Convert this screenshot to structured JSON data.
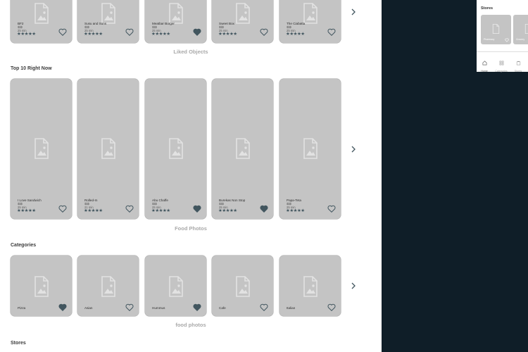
{
  "sections": {
    "top_row": {
      "caption": "Liked Objects",
      "cards": [
        {
          "name": "BF2",
          "price": "$$$",
          "time": "25 min",
          "liked": false
        },
        {
          "name": "Susu and Sons",
          "price": "$$$",
          "time": "25 min",
          "liked": false
        },
        {
          "name": "Meatbar Burger",
          "price": "$$$",
          "time": "25 min",
          "liked": true
        },
        {
          "name": "Sweet Box",
          "price": "$$$",
          "time": "25 min",
          "liked": false
        },
        {
          "name": "The Ciabatta",
          "price": "$$$",
          "time": "25 min",
          "liked": false
        }
      ]
    },
    "top10": {
      "title": "Top 10 Right Now",
      "caption": "Food Photos",
      "cards": [
        {
          "name": "I Love Sandwich",
          "price": "$$$",
          "time": "25 min",
          "liked": false
        },
        {
          "name": "Rolled-In",
          "price": "$$$",
          "time": "21 min",
          "liked": false
        },
        {
          "name": "Abu Chaffe",
          "price": "$$$",
          "time": "25 min",
          "liked": true
        },
        {
          "name": "Burekas Non Stop",
          "price": "$$$",
          "time": "25 min",
          "liked": true
        },
        {
          "name": "Papa-Teta",
          "price": "$$$",
          "time": "25 min",
          "liked": false
        }
      ]
    },
    "categories": {
      "title": "Categories",
      "caption": "food photos",
      "cards": [
        {
          "name": "Pizza",
          "liked": true
        },
        {
          "name": "Asian",
          "liked": false
        },
        {
          "name": "Hummus",
          "liked": true
        },
        {
          "name": "Cafe",
          "liked": false
        },
        {
          "name": "Italian",
          "liked": false
        }
      ]
    },
    "stores": {
      "title": "Stores"
    }
  },
  "stars": "★★★★★",
  "icons": {
    "placeholder": "image-placeholder-icon",
    "heart": "heart-icon",
    "arrow": "chevron-right-icon"
  },
  "colors": {
    "card": "#c4c4c4",
    "heart_fill": "#42565f",
    "dark_panel": "#0f1e28"
  },
  "phone": {
    "title": "Stores",
    "stores": [
      {
        "name": "Pharmacy"
      },
      {
        "name": "Grocery"
      }
    ],
    "tabs": [
      {
        "label": "Home",
        "icon": "home-icon"
      },
      {
        "label": "Categories",
        "icon": "grid-icon"
      },
      {
        "label": "Stores",
        "icon": "store-icon"
      }
    ]
  }
}
